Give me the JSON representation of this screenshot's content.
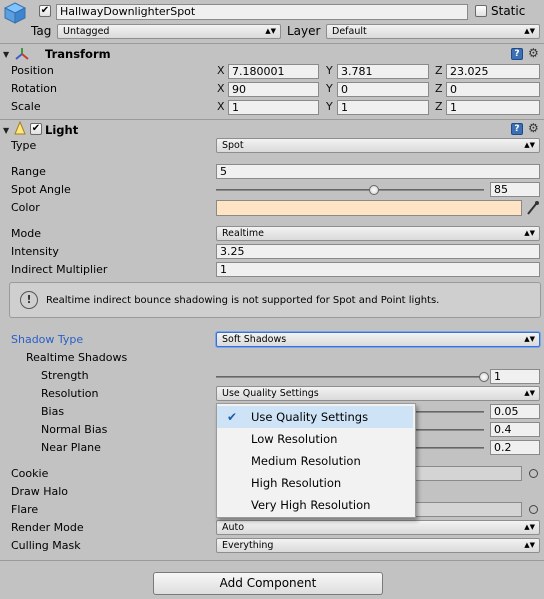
{
  "header": {
    "object_name": "HallwayDownlighterSpot",
    "active": true,
    "static_label": "Static",
    "static_checked": false,
    "tag_label": "Tag",
    "tag_value": "Untagged",
    "layer_label": "Layer",
    "layer_value": "Default"
  },
  "transform": {
    "title": "Transform",
    "position_label": "Position",
    "rotation_label": "Rotation",
    "scale_label": "Scale",
    "axes": {
      "x": "X",
      "y": "Y",
      "z": "Z"
    },
    "position": {
      "x": "7.180001",
      "y": "3.781",
      "z": "23.025"
    },
    "rotation": {
      "x": "90",
      "y": "0",
      "z": "0"
    },
    "scale": {
      "x": "1",
      "y": "1",
      "z": "1"
    }
  },
  "light": {
    "title": "Light",
    "enabled": true,
    "type_label": "Type",
    "type_value": "Spot",
    "range_label": "Range",
    "range_value": "5",
    "spot_angle_label": "Spot Angle",
    "spot_angle_value": "85",
    "spot_angle_fraction": 0.59,
    "color_label": "Color",
    "color_value": "#ffe4c4",
    "mode_label": "Mode",
    "mode_value": "Realtime",
    "intensity_label": "Intensity",
    "intensity_value": "3.25",
    "indirect_label": "Indirect Multiplier",
    "indirect_value": "1",
    "help_text": "Realtime indirect bounce shadowing is not supported for Spot and Point lights.",
    "shadow_type_label": "Shadow Type",
    "shadow_type_value": "Soft Shadows",
    "realtime_shadows_label": "Realtime Shadows",
    "strength_label": "Strength",
    "strength_value": "1",
    "strength_fraction": 1.0,
    "resolution_label": "Resolution",
    "resolution_value": "Use Quality Settings",
    "bias_label": "Bias",
    "bias_value": "0.05",
    "normal_bias_label": "Normal Bias",
    "normal_bias_value": "0.4",
    "near_plane_label": "Near Plane",
    "near_plane_value": "0.2",
    "cookie_label": "Cookie",
    "draw_halo_label": "Draw Halo",
    "flare_label": "Flare",
    "render_mode_label": "Render Mode",
    "render_mode_value": "Auto",
    "culling_mask_label": "Culling Mask",
    "culling_mask_value": "Everything"
  },
  "resolution_menu": {
    "items": [
      "Use Quality Settings",
      "Low Resolution",
      "Medium Resolution",
      "High Resolution",
      "Very High Resolution"
    ],
    "selected": "Use Quality Settings"
  },
  "add_component_label": "Add Component",
  "colors": {
    "accent_blue": "#2a5fc8",
    "panel": "#c2c2c2"
  }
}
